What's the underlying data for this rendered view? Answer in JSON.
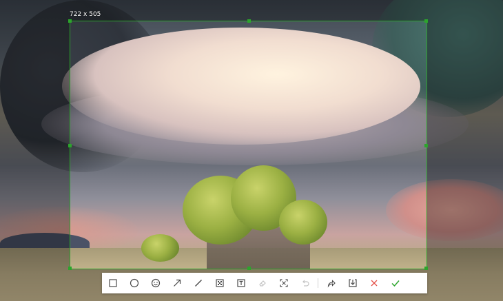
{
  "selection": {
    "size_label": "722 x 505"
  },
  "toolbar": {
    "tools": [
      {
        "icon": "rectangle-icon"
      },
      {
        "icon": "ellipse-icon"
      },
      {
        "icon": "emoji-icon"
      },
      {
        "icon": "arrow-icon"
      },
      {
        "icon": "line-icon"
      },
      {
        "icon": "mosaic-icon"
      },
      {
        "icon": "text-icon"
      },
      {
        "icon": "eraser-icon",
        "disabled": true
      },
      {
        "icon": "ocr-icon"
      },
      {
        "icon": "undo-icon",
        "disabled": true
      },
      {
        "icon": "share-icon"
      },
      {
        "icon": "save-icon"
      },
      {
        "icon": "close-icon"
      },
      {
        "icon": "confirm-icon"
      }
    ]
  },
  "colors": {
    "accent": "#2ca52c",
    "cancel": "#e5534b",
    "confirm": "#2ca52c",
    "icon": "#4a4a4a",
    "disabled": "#c4c4c4"
  }
}
